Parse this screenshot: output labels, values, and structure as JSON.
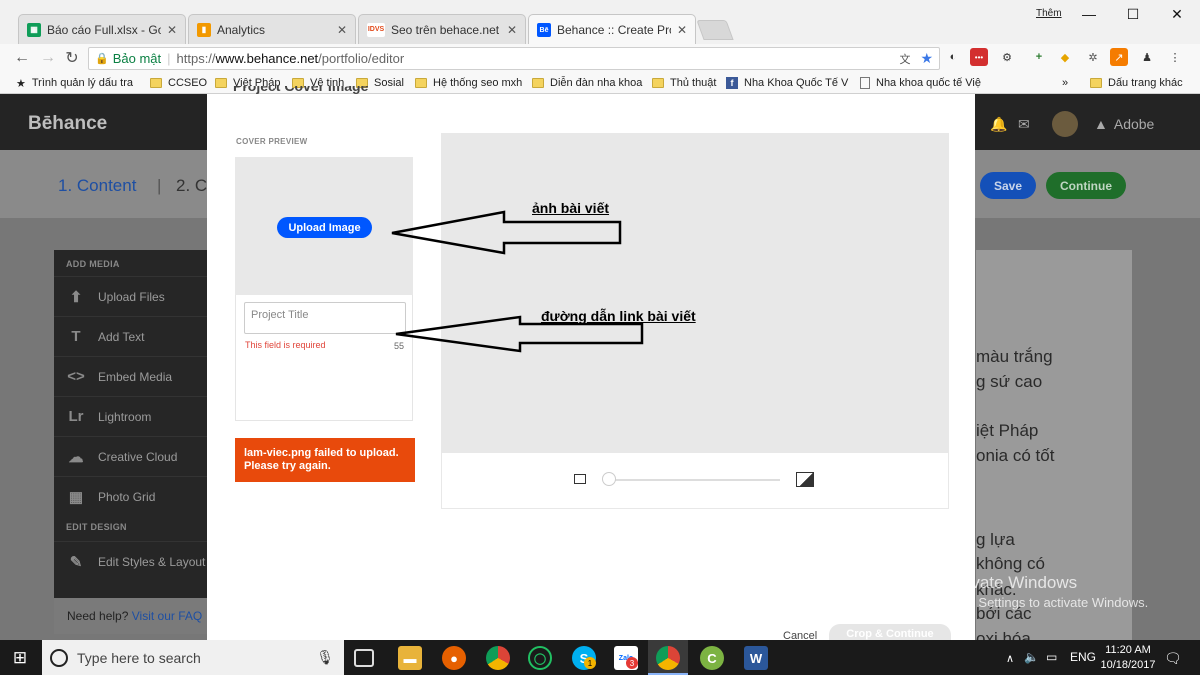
{
  "window": {
    "user_label": "Thêm",
    "minimize": "—",
    "maximize": "☐",
    "close": "✕"
  },
  "tabs": [
    {
      "label": "Báo cáo Full.xlsx - Google",
      "favicon": "sheets-icon",
      "color": "#0f9d58",
      "glyph": "▦"
    },
    {
      "label": "Analytics",
      "favicon": "analytics-icon",
      "color": "#f29900",
      "glyph": "▮"
    },
    {
      "label": "Seo trên behace.net cực",
      "favicon": "idvs-icon",
      "color": "#e24a1b",
      "glyph": "IDVS"
    },
    {
      "label": "Behance :: Create Project",
      "favicon": "behance-icon",
      "color": "#0057ff",
      "glyph": "Bē"
    }
  ],
  "address": {
    "secure_label": "Bảo mật",
    "url_prefix": "https://",
    "url_host": "www.behance.net",
    "url_path": "/portfolio/editor"
  },
  "bookmarks": [
    {
      "label": "Trình quản lý dấu tra",
      "type": "star"
    },
    {
      "label": "CCSEO",
      "type": "folder"
    },
    {
      "label": "Việt Pháp",
      "type": "folder"
    },
    {
      "label": "Vệ tinh",
      "type": "folder"
    },
    {
      "label": "Sosial",
      "type": "folder"
    },
    {
      "label": "Hệ thống seo mxh",
      "type": "folder"
    },
    {
      "label": "Diễn đàn nha khoa",
      "type": "folder"
    },
    {
      "label": "Thủ thuật",
      "type": "folder"
    },
    {
      "label": "Nha Khoa Quốc Tế V",
      "type": "facebook"
    },
    {
      "label": "Nha khoa quốc tế Việ",
      "type": "page"
    }
  ],
  "bookmarks_more": "»",
  "bookmarks_other": "Dấu trang khác",
  "behance": {
    "logo": "Bēhance",
    "adobe": "Adobe",
    "step1": "1. Content",
    "step2": "2. C",
    "save": "Save",
    "continue": "Continue"
  },
  "left_panel": {
    "add_media": "ADD MEDIA",
    "items": [
      {
        "label": "Upload Files",
        "icon": "upload-icon",
        "glyph": "⬆"
      },
      {
        "label": "Add Text",
        "icon": "text-icon",
        "glyph": "T"
      },
      {
        "label": "Embed Media",
        "icon": "embed-icon",
        "glyph": "<>"
      },
      {
        "label": "Lightroom",
        "icon": "lightroom-icon",
        "glyph": "Lr"
      },
      {
        "label": "Creative Cloud",
        "icon": "creative-cloud-icon",
        "glyph": "☁"
      },
      {
        "label": "Photo Grid",
        "icon": "photo-grid-icon",
        "glyph": "▦"
      }
    ],
    "edit_design": "EDIT DESIGN",
    "edit_styles": "Edit Styles & Layout",
    "help": "Need help?",
    "help_link": "Visit our FAQ →"
  },
  "right_doc": [
    "màu trắng",
    "g sứ cao",
    "iệt Pháp",
    "onia có tốt",
    "g lựa",
    "không có",
    "khác.",
    "bởi các",
    "oxi hóa"
  ],
  "modal": {
    "heading": "Project Cover Image",
    "cover_preview": "COVER PREVIEW",
    "upload_button": "Upload Image",
    "title_placeholder": "Project Title",
    "required_error": "This field is required",
    "char_count": "55",
    "upload_error": "lam-viec.png failed to upload. Please try again.",
    "cancel": "Cancel",
    "crop_continue": "Crop & Continue"
  },
  "annotations": {
    "arrow1": "ảnh bài viết",
    "arrow2": "đường dẫn link bài viết"
  },
  "watermark": {
    "line1": "Activate Windows",
    "line2": "Go to Settings to activate Windows."
  },
  "taskbar": {
    "search_placeholder": "Type here to search",
    "lang": "ENG",
    "time": "11:20 AM",
    "date": "10/18/2017",
    "badge_skype": "1",
    "badge_zalo": "3"
  }
}
